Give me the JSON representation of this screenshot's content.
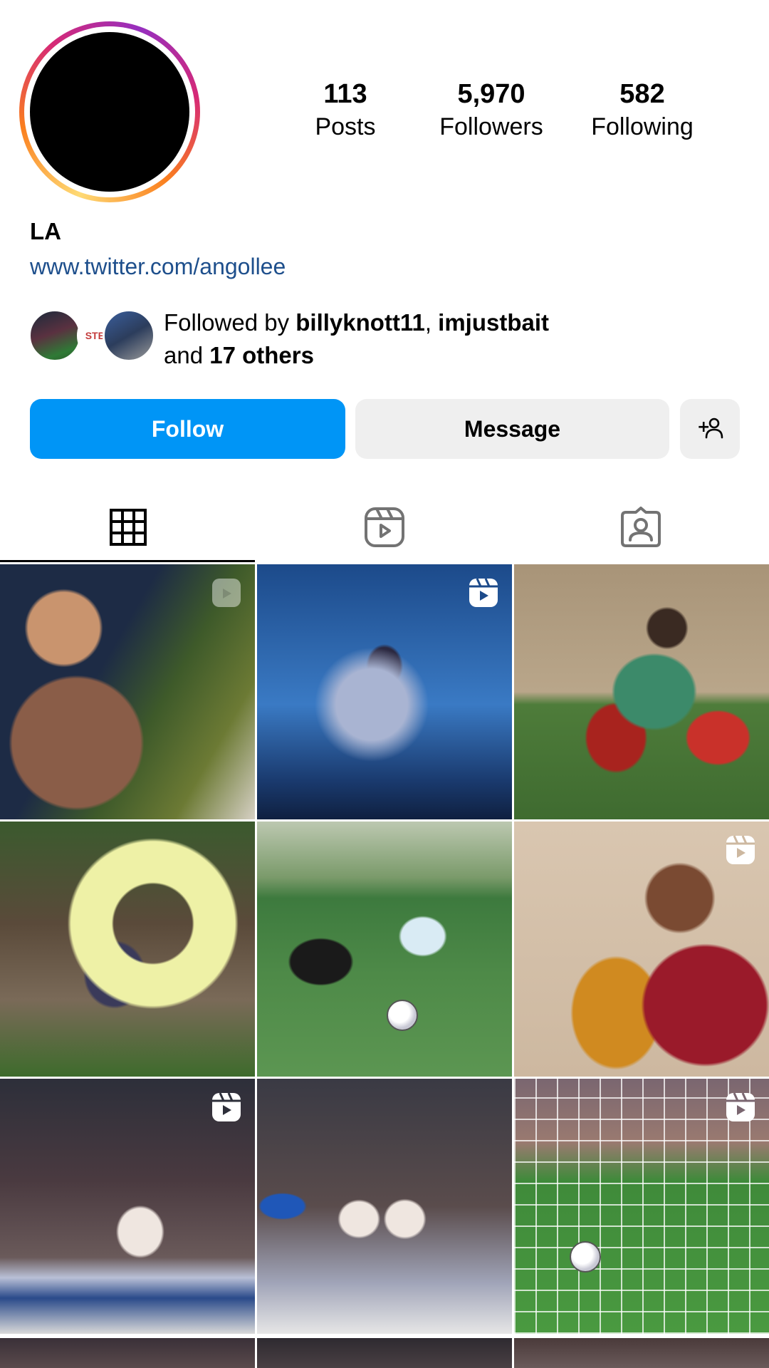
{
  "profile": {
    "name": "LA",
    "link": "www.twitter.com/angollee"
  },
  "stats": [
    {
      "value": "113",
      "label": "Posts"
    },
    {
      "value": "5,970",
      "label": "Followers"
    },
    {
      "value": "582",
      "label": "Following"
    }
  ],
  "followed_by": {
    "prefix": "Followed by ",
    "user1": "billyknott11",
    "separator": ", ",
    "user2": "imjustbait",
    "line2_prefix": "and ",
    "others": "17 others",
    "badge_text": "STBAIT"
  },
  "buttons": {
    "follow": "Follow",
    "message": "Message",
    "add_user_icon": "add-person-icon"
  },
  "tabs": [
    {
      "icon": "grid-icon",
      "active": true
    },
    {
      "icon": "reels-icon",
      "active": false
    },
    {
      "icon": "tagged-icon",
      "active": false
    }
  ],
  "posts": [
    {
      "reel": true
    },
    {
      "reel": true
    },
    {
      "reel": false
    },
    {
      "reel": false
    },
    {
      "reel": false
    },
    {
      "reel": true
    },
    {
      "reel": true
    },
    {
      "reel": false
    },
    {
      "reel": true
    }
  ],
  "colors": {
    "accent": "#0095f6",
    "link": "#1e4f8c"
  }
}
